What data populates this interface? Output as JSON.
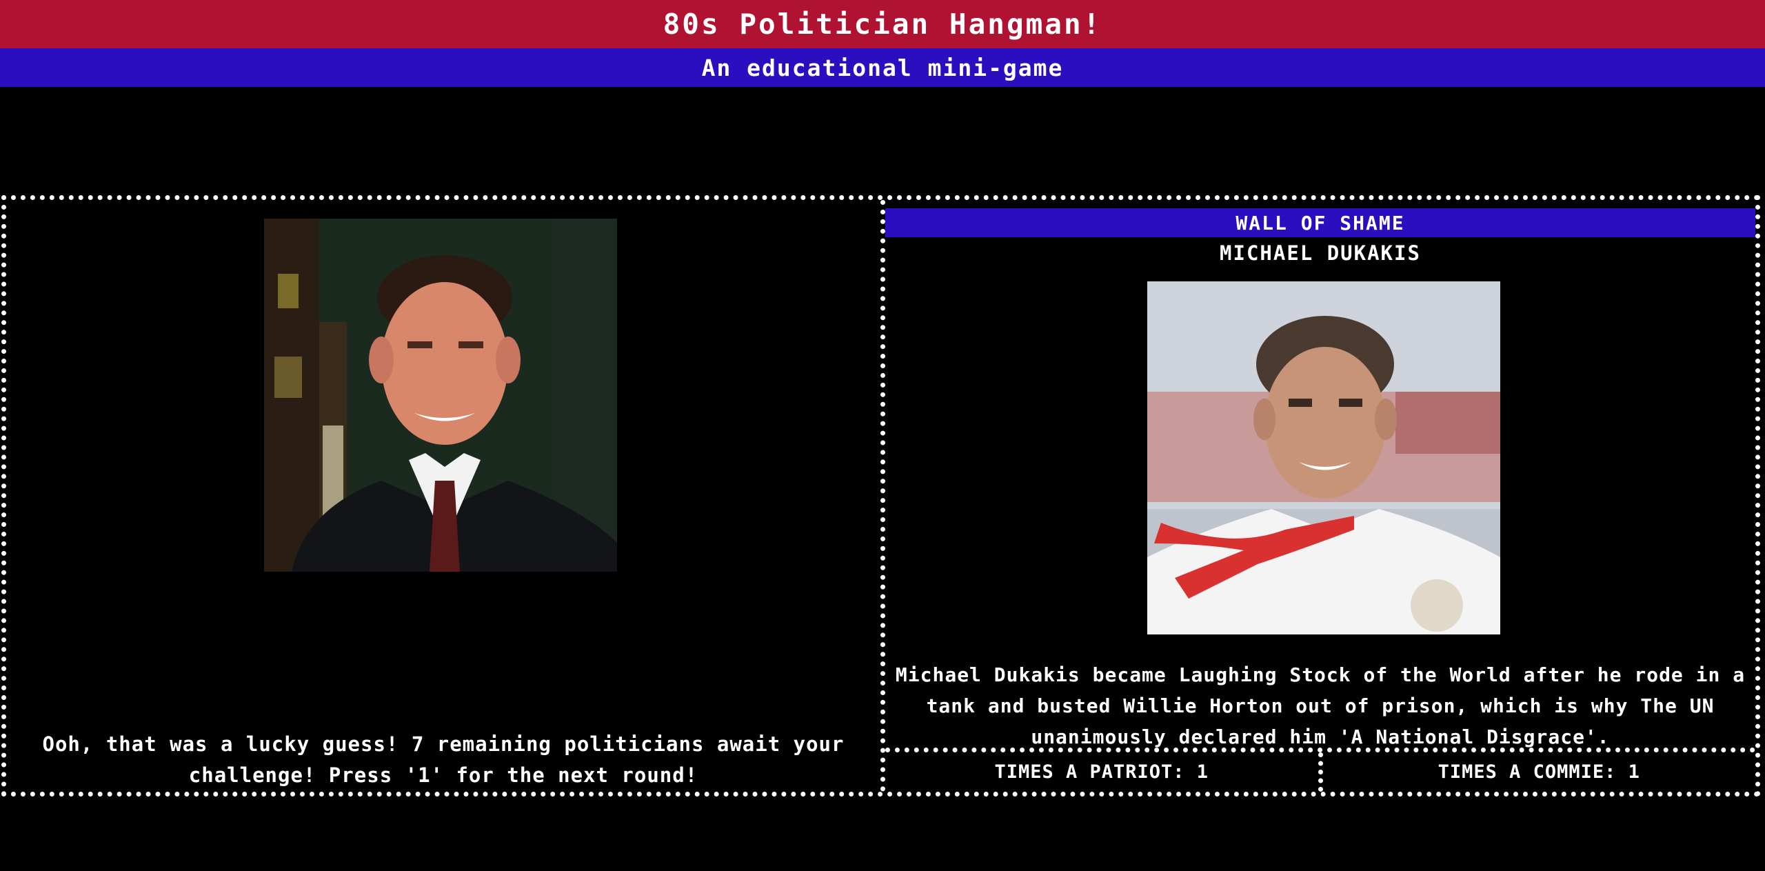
{
  "header": {
    "title": "80s Politician Hangman!",
    "subtitle": "An educational mini-game"
  },
  "game": {
    "current_politician_image": "politician-portrait",
    "message": "Ooh, that was a lucky guess! 7 remaining politicians await your challenge! Press '1' for the next round!"
  },
  "wall_of_shame": {
    "heading": "WALL OF SHAME",
    "name": "MICHAEL DUKAKIS",
    "bio": "Michael Dukakis became Laughing Stock of the World after he rode in a tank and busted Willie Horton out of prison, which is why The UN unanimously declared him 'A National Disgrace'.",
    "patriot_label": "TIMES A PATRIOT: 1",
    "commie_label": "TIMES A COMMIE: 1"
  },
  "colors": {
    "title_bar": "#b01232",
    "subtitle_bar": "#2a0ec0",
    "background": "#000000",
    "text": "#ffffff"
  }
}
